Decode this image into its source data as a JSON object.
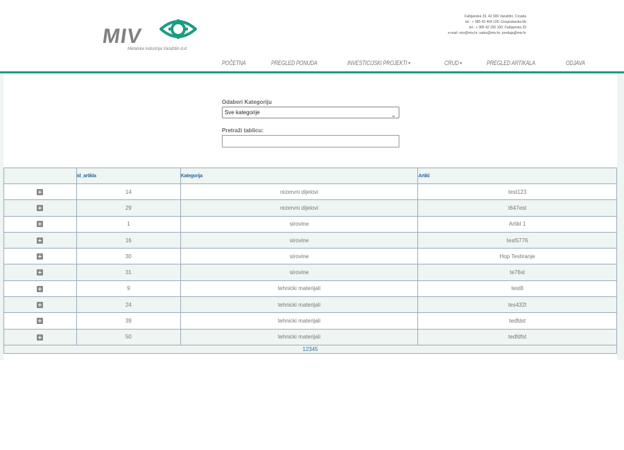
{
  "brand": {
    "logo_text": "MIV",
    "tagline": "Metalska industrija Varaždin d.d."
  },
  "contact": {
    "lines": [
      "Fabijanska 33, 42 000 Varaždin, Croatia",
      "tel.: + 385 42 404 100; Gospodarska bb",
      "tel.: + 385 42 290 100; Fabijanska 33",
      "e-mail: miv@miv.hr; sales@miv.hr; prodaja@miv.hr"
    ]
  },
  "nav": {
    "items": [
      {
        "label": "POČETNA",
        "dropdown": false
      },
      {
        "label": "PREGLED PONUDA",
        "dropdown": false
      },
      {
        "label": "INVESTICIJSKI PROJEKTI",
        "dropdown": true
      },
      {
        "label": "CRUD",
        "dropdown": true
      },
      {
        "label": "PREGLED ARTIKALA",
        "dropdown": false
      },
      {
        "label": "ODJAVA",
        "dropdown": false
      }
    ]
  },
  "filter": {
    "category_label": "Odaberi Kategoriju",
    "category_value": "Sve kategorije",
    "search_label": "Pretraži tablicu:",
    "search_value": ""
  },
  "table": {
    "columns": [
      "",
      "id_artikla",
      "Kategorija",
      "Artikl"
    ],
    "rows": [
      {
        "id": "14",
        "category": "rezervni dijelovi",
        "item": "test123"
      },
      {
        "id": "29",
        "category": "rezervni dijelovi",
        "item": "t647est"
      },
      {
        "id": "1",
        "category": "sirovine",
        "item": "Artikl 1"
      },
      {
        "id": "16",
        "category": "sirovine",
        "item": "test5776"
      },
      {
        "id": "30",
        "category": "sirovine",
        "item": "Hop Testiranje"
      },
      {
        "id": "31",
        "category": "sirovine",
        "item": "te76st"
      },
      {
        "id": "9",
        "category": "tehnicki materijali",
        "item": "test8"
      },
      {
        "id": "24",
        "category": "tehnicki materijali",
        "item": "tes432t"
      },
      {
        "id": "39",
        "category": "tehnicki materijali",
        "item": "tedfdst"
      },
      {
        "id": "50",
        "category": "tehnicki materijali",
        "item": "tedfdfst"
      }
    ],
    "pager": [
      "1",
      "2",
      "3",
      "4",
      "5"
    ]
  },
  "colors": {
    "accent": "#1a9c82",
    "row_alt": "#eef5f2",
    "header_text": "#2f6fa3"
  }
}
